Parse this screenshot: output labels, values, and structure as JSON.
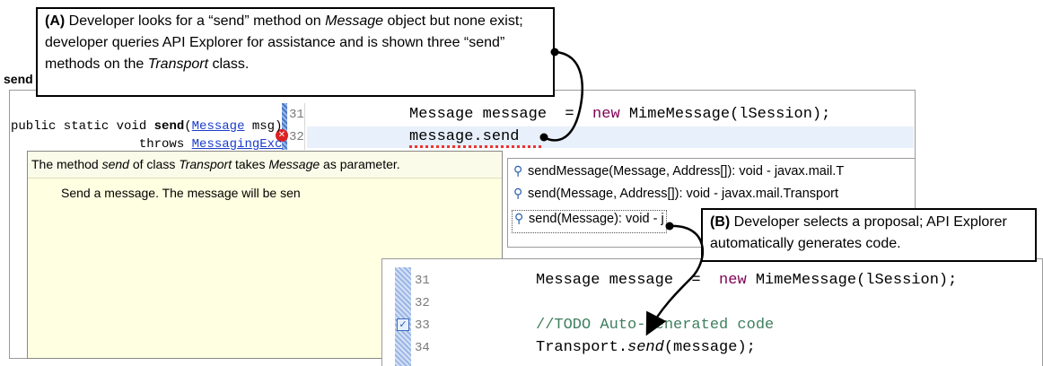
{
  "editor_top": {
    "line_31": {
      "number": "31",
      "code_pre": "Message message  =  ",
      "keyword": "new",
      "code_post": " MimeMessage(lSession);"
    },
    "line_32": {
      "number": "32",
      "code": "message.send"
    }
  },
  "javadoc": {
    "summary_pre": "The method ",
    "summary_method": "send",
    "summary_mid": " of class ",
    "summary_class": "Transport",
    "summary_mid2": " takes ",
    "summary_param": "Message",
    "summary_post": " as parameter.",
    "title": "send",
    "sig1_pre": "public static void ",
    "sig1_method": "send",
    "sig1_open": "(",
    "sig1_type": "Message",
    "sig1_arg": " msg)",
    "sig2_pre": "                 throws ",
    "sig2_exc": "MessagingExc",
    "desc": "Send a message. The message will be sen"
  },
  "proposals": [
    {
      "label": "sendMessage(Message, Address[]): void - javax.mail.T"
    },
    {
      "label": "send(Message, Address[]): void - javax.mail.Transport"
    },
    {
      "label": "send(Message): void - j"
    }
  ],
  "editor_bottom": {
    "line_31": {
      "number": "31",
      "code_pre": "Message message  =  ",
      "keyword": "new",
      "code_post": " MimeMessage(lSession);"
    },
    "line_32": {
      "number": "32"
    },
    "line_33": {
      "number": "33",
      "comment": "//TODO Auto-generated code"
    },
    "line_34": {
      "number": "34",
      "code_pre": "Transport.",
      "method": "send",
      "code_post": "(message);"
    }
  },
  "callout_a": {
    "label": "(A)",
    "text1": " Developer looks for a “send” method on ",
    "obj": "Message",
    "text2": " object but none exist; developer queries API Explorer for assistance and is shown three “send” methods on the ",
    "cls": "Transport",
    "text3": " class."
  },
  "callout_b": {
    "label": "(B)",
    "text": " Developer selects a proposal; API Explorer automatically generates code."
  },
  "icons": {
    "error": "error-icon",
    "proposal": "magnifier-icon",
    "quickfix": "checkbox-icon"
  }
}
